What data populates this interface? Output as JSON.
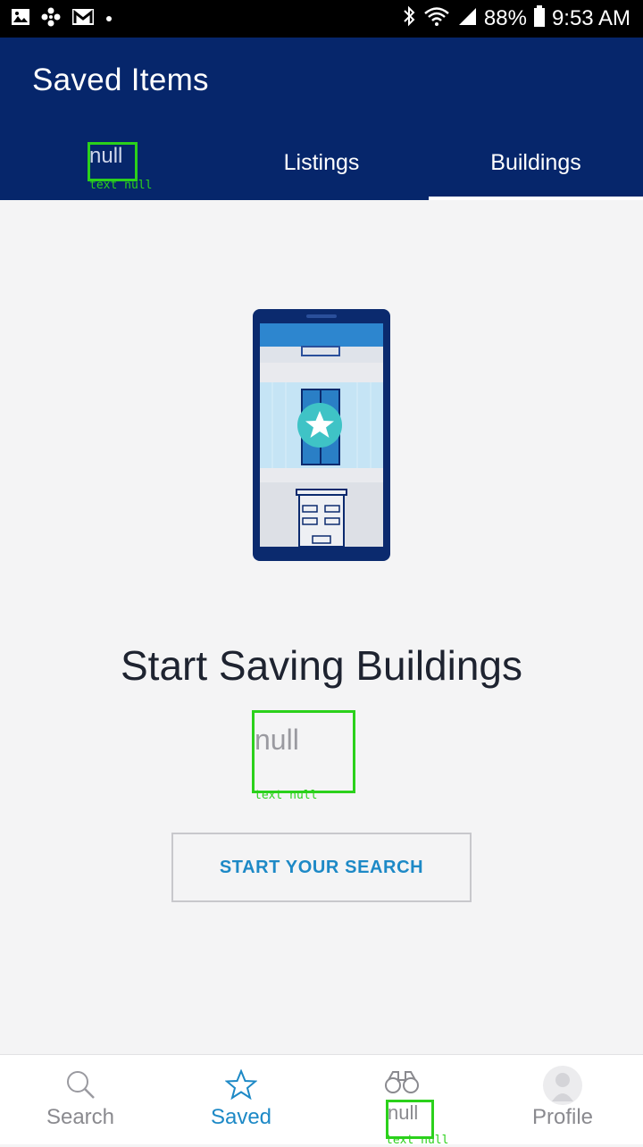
{
  "status_bar": {
    "battery": "88%",
    "time": "9:53 AM",
    "left_icons": [
      "image-icon",
      "pinwheel-icon",
      "gmail-icon",
      "dot-icon"
    ],
    "right_icons": [
      "bluetooth-icon",
      "wifi-icon",
      "signal-icon",
      "battery-icon"
    ]
  },
  "header": {
    "title": "Saved Items",
    "tabs": [
      {
        "label": "null",
        "caption": "text null"
      },
      {
        "label": "Listings"
      },
      {
        "label": "Buildings",
        "active": true
      }
    ]
  },
  "empty_state": {
    "headline": "Start Saving Buildings",
    "subtext": "null",
    "subtext_caption": "text null",
    "cta_label": "START YOUR SEARCH",
    "illustration": "phone-building-star-illustration"
  },
  "bottom_nav": {
    "items": [
      {
        "label": "Search",
        "icon": "search-icon"
      },
      {
        "label": "Saved",
        "icon": "star-icon",
        "active": true
      },
      {
        "label": "null",
        "icon": "binoculars-icon",
        "caption": "text null"
      },
      {
        "label": "Profile",
        "icon": "avatar-icon"
      }
    ]
  },
  "colors": {
    "header_bg": "#06266b",
    "accent": "#1d89c6",
    "page_bg": "#f4f4f5",
    "debug_box": "#2bd11b"
  }
}
